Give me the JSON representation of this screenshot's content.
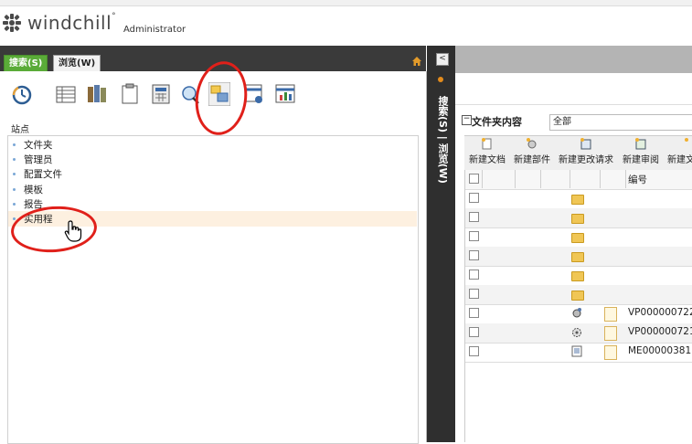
{
  "header": {
    "logo_text": "windchill",
    "logo_mark": "°",
    "user_role": "Administrator"
  },
  "left_panel": {
    "tabs": [
      {
        "label": "搜索(S)",
        "active": true
      },
      {
        "label": "浏览(W)",
        "active": false
      }
    ],
    "toolbar_icons": [
      "recent-icon",
      "list-icon",
      "books-icon",
      "clipboard-icon",
      "calculator-icon",
      "search-globe-icon",
      "site-icon",
      "query-icon",
      "report-icon"
    ],
    "site_label": "站点",
    "tree_items": [
      "文件夹",
      "管理员",
      "配置文件",
      "模板",
      "报告",
      "实用程"
    ],
    "selected_index": 5
  },
  "divider": {
    "collapse": "<",
    "vertical_text": "搜索(S) | 浏览(W)"
  },
  "right_panel": {
    "title": "文件夹内容",
    "filter_value": "全部",
    "actions": [
      "新建文档",
      "新建部件",
      "新建更改请求",
      "新建审阅",
      "新建文"
    ],
    "column_header": "编号",
    "rows": [
      {
        "type": "folder",
        "number": ""
      },
      {
        "type": "folder",
        "number": ""
      },
      {
        "type": "folder",
        "number": ""
      },
      {
        "type": "folder",
        "number": ""
      },
      {
        "type": "folder",
        "number": ""
      },
      {
        "type": "folder",
        "number": ""
      },
      {
        "type": "part",
        "number": "VP000000722"
      },
      {
        "type": "part",
        "number": "VP000000721"
      },
      {
        "type": "document",
        "number": "ME00000381"
      }
    ]
  },
  "colors": {
    "active_tab": "#5aab38",
    "dark_bar": "#3a3a3a",
    "annotation": "#e0201a",
    "selection": "#fdf0e0"
  }
}
